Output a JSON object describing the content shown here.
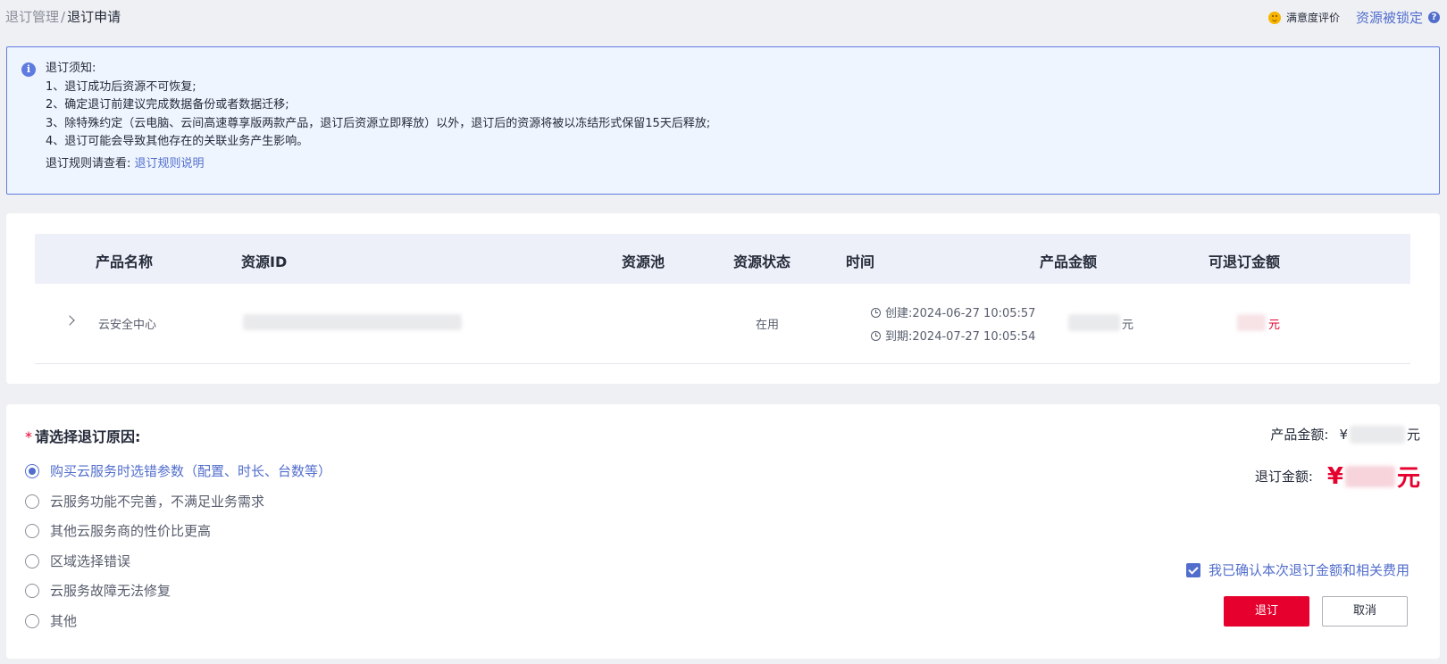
{
  "breadcrumb": {
    "parent": "退订管理",
    "separator": "/",
    "current": "退订申请"
  },
  "header": {
    "rating_label": "满意度评价",
    "locked_link": "资源被锁定",
    "help_glyph": "?"
  },
  "notice": {
    "info_glyph": "i",
    "title": "退订须知:",
    "lines": [
      "1、退订成功后资源不可恢复;",
      "2、确定退订前建议完成数据备份或者数据迁移;",
      "3、除特殊约定（云电脑、云间高速尊享版两款产品，退订后资源立即释放）以外，退订后的资源将被以冻结形式保留15天后释放;",
      "4、退订可能会导致其他存在的关联业务产生影响。"
    ],
    "rule_prefix": "退订规则请查看:",
    "rule_link": "退订规则说明"
  },
  "table": {
    "columns": [
      "产品名称",
      "资源ID",
      "资源池",
      "资源状态",
      "时间",
      "产品金额",
      "可退订金额"
    ],
    "rows": [
      {
        "product": "云安全中心",
        "resource_id": "",
        "pool": "",
        "status": "在用",
        "created": "创建:2024-06-27 10:05:57",
        "expires": "到期:2024-07-27 10:05:54",
        "product_amount_unit": "元",
        "refund_amount_unit": "元"
      }
    ]
  },
  "reason": {
    "required_mark": "*",
    "title": "请选择退订原因:",
    "options": [
      "购买云服务时选错参数（配置、时长、台数等）",
      "云服务功能不完善，不满足业务需求",
      "其他云服务商的性价比更高",
      "区域选择错误",
      "云服务故障无法修复",
      "其他"
    ],
    "selected_index": 0
  },
  "summary": {
    "product_amount_label": "产品金额:",
    "currency": "¥",
    "unit": "元",
    "refund_label": "退订金额:",
    "refund_currency": "¥",
    "refund_unit": "元"
  },
  "confirm": {
    "label": "我已确认本次退订金额和相关费用",
    "checked": true
  },
  "buttons": {
    "submit": "退订",
    "cancel": "取消"
  },
  "colors": {
    "accent": "#526ecc",
    "danger": "#e6002e",
    "notice_bg": "#eef5ff"
  }
}
